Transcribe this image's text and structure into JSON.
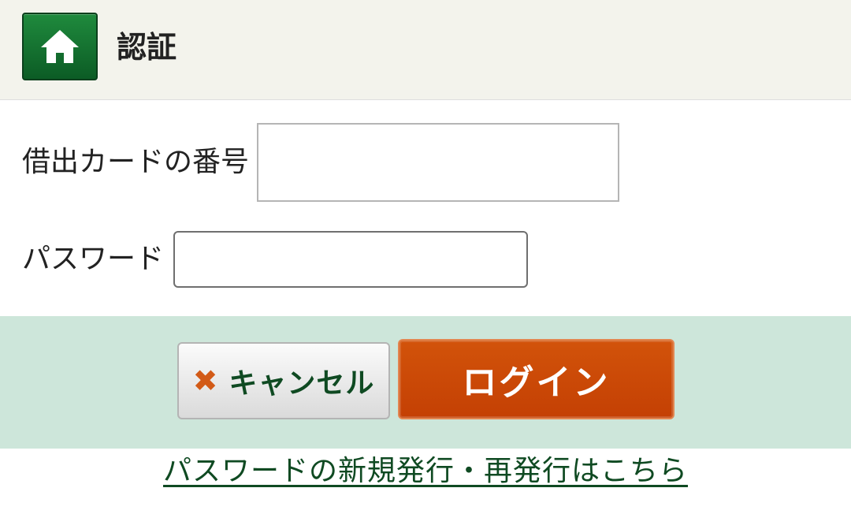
{
  "header": {
    "home_icon": "home-icon",
    "title": "認証"
  },
  "form": {
    "card_number": {
      "label": "借出カードの番号",
      "value": "",
      "placeholder": ""
    },
    "password": {
      "label": "パスワード",
      "value": "",
      "placeholder": ""
    }
  },
  "actions": {
    "cancel_icon": "close-icon",
    "cancel_glyph": "✖",
    "cancel_label": "キャンセル",
    "login_label": "ログイン"
  },
  "links": {
    "reissue": "パスワードの新規発行・再発行はこちら"
  },
  "colors": {
    "header_bg": "#f3f3ec",
    "home_button": "#1a7a35",
    "action_band": "#cde6da",
    "login_button": "#c9470a",
    "cancel_icon": "#d25a17",
    "link_text": "#0f4a22"
  }
}
